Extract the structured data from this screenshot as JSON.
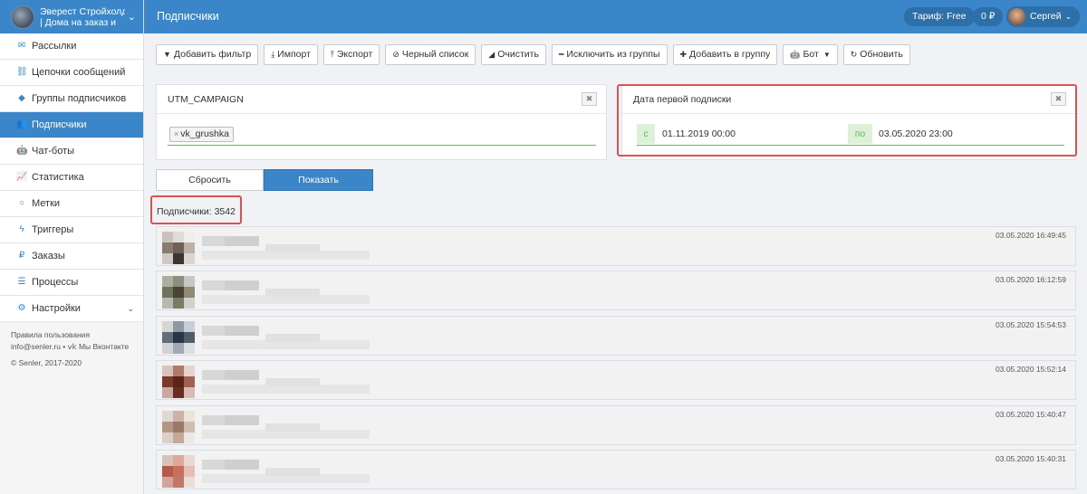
{
  "brand": {
    "line1": "Эверест Стройхолдинг",
    "line2": "| Дома на заказ и"
  },
  "sidebar": {
    "items": [
      {
        "label": "Рассылки",
        "icon": "envelope-icon",
        "glyph": "✉"
      },
      {
        "label": "Цепочки сообщений",
        "icon": "link-icon",
        "glyph": "⛓"
      },
      {
        "label": "Группы подписчиков",
        "icon": "tag-icon",
        "glyph": "◆"
      },
      {
        "label": "Подписчики",
        "icon": "users-icon",
        "glyph": "👥"
      },
      {
        "label": "Чат-боты",
        "icon": "android-icon",
        "glyph": "🤖"
      },
      {
        "label": "Статистика",
        "icon": "chart-icon",
        "glyph": "📈"
      },
      {
        "label": "Метки",
        "icon": "circle-icon",
        "glyph": "○"
      },
      {
        "label": "Триггеры",
        "icon": "bolt-icon",
        "glyph": "ϟ"
      },
      {
        "label": "Заказы",
        "icon": "ruble-icon",
        "glyph": "₽"
      },
      {
        "label": "Процессы",
        "icon": "list-icon",
        "glyph": "☰"
      },
      {
        "label": "Настройки",
        "icon": "gears-icon",
        "glyph": "⚙"
      }
    ],
    "footer": {
      "rules": "Правила пользования",
      "email": "info@senler.ru",
      "vk": " • 𝗏𝗄 Мы Вконтакте",
      "copyright": "© Senler, 2017-2020"
    }
  },
  "header": {
    "title": "Подписчики",
    "tariff": "Тариф: Free",
    "balance": "0 ₽",
    "user": "Сергей"
  },
  "toolbar": {
    "add_filter": "Добавить фильтр",
    "import": "Импорт",
    "export": "Экспорт",
    "blacklist": "Черный список",
    "clear": "Очистить",
    "exclude": "Исключить из группы",
    "add_group": "Добавить в группу",
    "bot": "Бот",
    "refresh": "Обновить"
  },
  "filters": {
    "utm": {
      "title": "UTM_CAMPAIGN",
      "tag": "vk_grushka"
    },
    "date": {
      "title": "Дата первой подписки",
      "from_label": "с",
      "from_value": "01.11.2019 00:00",
      "to_label": "по",
      "to_value": "03.05.2020 23:00"
    }
  },
  "actions": {
    "reset": "Сбросить",
    "show": "Показать"
  },
  "count_text": "Подписчики: 3542",
  "rows": [
    {
      "time": "03.05.2020 16:49:45",
      "colors": [
        "#c9c2bd",
        "#e2dcd8",
        "#efeeee",
        "#8a7b70",
        "#6e6258",
        "#b9b1aa",
        "#cfc9c4",
        "#3c352f",
        "#d9d4cf"
      ]
    },
    {
      "time": "03.05.2020 16:12:59",
      "colors": [
        "#a9b0a0",
        "#8b8f7f",
        "#c7c9c0",
        "#6f735f",
        "#4a4436",
        "#8e8a78",
        "#b8bab0",
        "#7b7a66",
        "#d0d1ca"
      ]
    },
    {
      "time": "03.05.2020 15:54:53",
      "colors": [
        "#d6d6d6",
        "#8e98a3",
        "#c9ced4",
        "#606d7b",
        "#2a3446",
        "#4f5c6c",
        "#cfd2d6",
        "#a2a9b3",
        "#dcdee1"
      ]
    },
    {
      "time": "03.05.2020 15:52:14",
      "colors": [
        "#d9c4bd",
        "#b07a6a",
        "#e3d6d1",
        "#7a3a2a",
        "#5a2418",
        "#a26052",
        "#c8a8a0",
        "#6a2c20",
        "#d8bcb4"
      ]
    },
    {
      "time": "03.05.2020 15:40:47",
      "colors": [
        "#e0d8d2",
        "#cbb4a6",
        "#eae4df",
        "#b49684",
        "#9a7a68",
        "#d2bcae",
        "#dad0c8",
        "#c4a898",
        "#ece8e4"
      ]
    },
    {
      "time": "03.05.2020 15:40:31",
      "colors": [
        "#d8c2bc",
        "#e0a89c",
        "#ead8d4",
        "#b85a48",
        "#c8705e",
        "#e6beb4",
        "#d4a49a",
        "#c27868",
        "#eadcd8"
      ]
    }
  ]
}
